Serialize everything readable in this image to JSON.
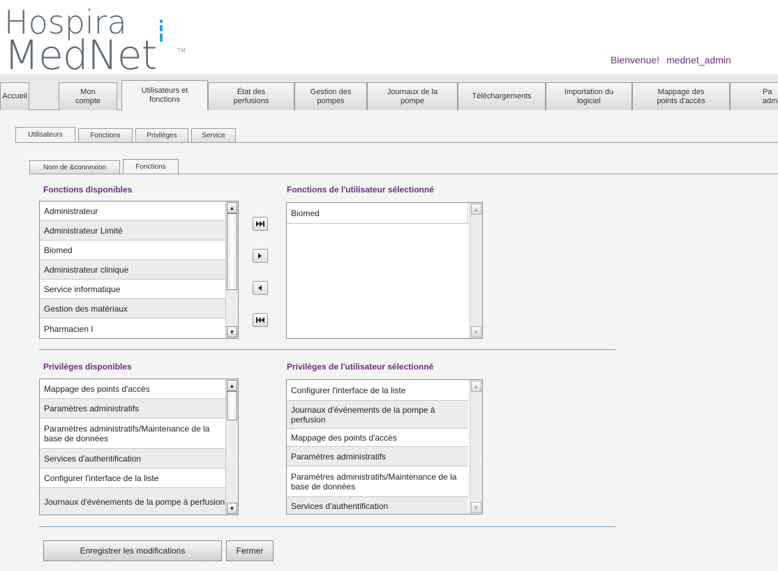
{
  "header": {
    "logo_line1": "Hospira",
    "logo_line2": "MedNet",
    "logo_tm": "TM",
    "welcome_label": "Bienvenue!",
    "username": "mednet_admin"
  },
  "nav": {
    "tabs": [
      {
        "label": "Accueil"
      },
      {
        "label": "Mon compte"
      },
      {
        "label": "Utilisateurs et fonctions",
        "active": true
      },
      {
        "label": "État des perfusions"
      },
      {
        "label": "Gestion des pompes"
      },
      {
        "label": "Journaux de la pompe"
      },
      {
        "label": "Téléchargements"
      },
      {
        "label": "Importation du logiciel"
      },
      {
        "label": "Mappage des points d'accès"
      },
      {
        "label": "Pa adm"
      }
    ]
  },
  "subtabs": [
    {
      "label": "Utilisateurs",
      "active": true
    },
    {
      "label": "Fonctions"
    },
    {
      "label": "Privilèges"
    },
    {
      "label": "Service"
    }
  ],
  "inner_tabs": [
    {
      "label": "Nom de &connexion"
    },
    {
      "label": "Fonctions",
      "active": true
    }
  ],
  "functions": {
    "available_title": "Fonctions disponibles",
    "selected_title": "Fonctions de l'utilisateur sélectionné",
    "available": [
      "Administrateur",
      "Administrateur Limité",
      "Biomed",
      "Administrateur clinique",
      "Service informatique",
      "Gestion des matériaux",
      "Pharmacien I"
    ],
    "selected": [
      "Biomed"
    ]
  },
  "privileges": {
    "available_title": "Privilèges disponibles",
    "selected_title": "Privilèges de l'utilisateur sélectionné",
    "available": [
      "Mappage des points d'accès",
      "Paramètres administratifs",
      "Paramètres administratifs/Maintenance de la base de données",
      "Services d'authentification",
      "Configurer l'interface de la liste",
      "Journaux d'événements de la pompe à perfusion"
    ],
    "selected": [
      "Configurer l'interface de la liste",
      "Journaux d'événements de la pompe à perfusion",
      "Mappage des points d'accès",
      "Paramètres administratifs",
      "Paramètres administratifs/Maintenance de la base de données",
      "Services d'authentification"
    ]
  },
  "actions": {
    "save_label": "Enregistrer les modifications",
    "close_label": "Fermer"
  },
  "colors": {
    "accent_purple": "#6b2d7d",
    "logo_gray": "#5f6975",
    "logo_blue": "#27a9d9",
    "divider_blue": "#7a9cc0"
  }
}
